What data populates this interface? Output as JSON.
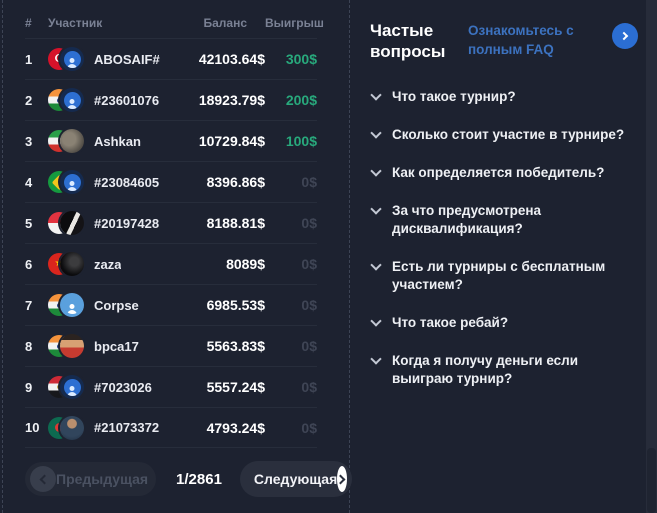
{
  "table": {
    "headers": {
      "rank": "#",
      "participant": "Участник",
      "balance": "Баланс",
      "win": "Выигрыш"
    },
    "rows": [
      {
        "rank": "1",
        "name": "ABOSAIF#",
        "balance": "42103.64$",
        "win": "300$",
        "win_positive": true,
        "flag": "turkey",
        "avatar": "default-blue"
      },
      {
        "rank": "2",
        "name": "#23601076",
        "balance": "18923.79$",
        "win": "200$",
        "win_positive": true,
        "flag": "india",
        "avatar": "default-blue"
      },
      {
        "rank": "3",
        "name": "Ashkan",
        "balance": "10729.84$",
        "win": "100$",
        "win_positive": true,
        "flag": "iran",
        "avatar": "photo-gray"
      },
      {
        "rank": "4",
        "name": "#23084605",
        "balance": "8396.86$",
        "win": "0$",
        "win_positive": false,
        "flag": "brazil",
        "avatar": "default-blue"
      },
      {
        "rank": "5",
        "name": "#20197428",
        "balance": "8188.81$",
        "win": "0$",
        "win_positive": false,
        "flag": "indonesia",
        "avatar": "photo-dark"
      },
      {
        "rank": "6",
        "name": "zaza",
        "balance": "8089$",
        "win": "0$",
        "win_positive": false,
        "flag": "vietnam",
        "avatar": "photo-black"
      },
      {
        "rank": "7",
        "name": "Corpse",
        "balance": "6985.53$",
        "win": "0$",
        "win_positive": false,
        "flag": "india",
        "avatar": "light-blue"
      },
      {
        "rank": "8",
        "name": "bpca17",
        "balance": "5563.83$",
        "win": "0$",
        "win_positive": false,
        "flag": "india",
        "avatar": "cartoon-red"
      },
      {
        "rank": "9",
        "name": "#7023026",
        "balance": "5557.24$",
        "win": "0$",
        "win_positive": false,
        "flag": "egypt",
        "avatar": "default-blue"
      },
      {
        "rank": "10",
        "name": "#21073372",
        "balance": "4793.24$",
        "win": "0$",
        "win_positive": false,
        "flag": "bangladesh",
        "avatar": "photo-suit"
      }
    ]
  },
  "pagination": {
    "prev_label": "Предыдущая",
    "page_indicator": "1/2861",
    "next_label": "Следующая"
  },
  "faq": {
    "title": "Частые вопросы",
    "link_label": "Ознакомьтесь с полным FAQ",
    "questions": [
      "Что такое турнир?",
      "Сколько стоит участие в турнире?",
      "Как определяется победитель?",
      "За что предусмотрена дисквалификация?",
      "Есть ли турниры с бесплатным участием?",
      "Что такое ребай?",
      "Когда я получу деньги если выиграю турнир?"
    ]
  },
  "icons": {
    "turkey_emblem": "☪",
    "vietnam_emblem": "★"
  },
  "colors": {
    "background": "#1d2230",
    "win_green": "#28a97c",
    "zero_gray": "#3f4555",
    "link_blue": "#3c72bf",
    "accent_blue": "#2b6ed3"
  }
}
